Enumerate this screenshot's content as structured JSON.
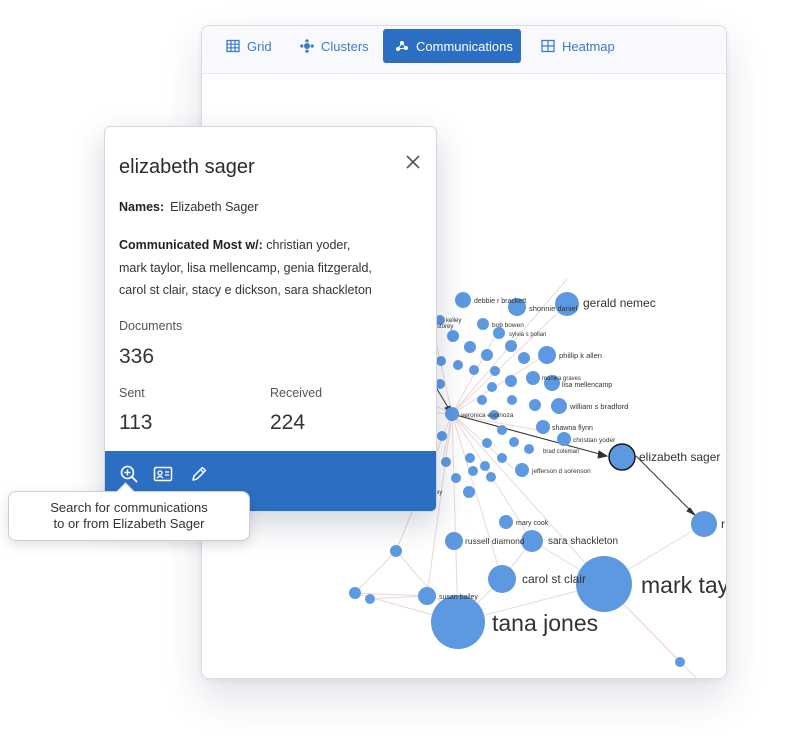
{
  "tabs": [
    {
      "label": "Grid",
      "icon": "grid-icon",
      "active": false
    },
    {
      "label": "Clusters",
      "icon": "clusters-icon",
      "active": false
    },
    {
      "label": "Communications",
      "icon": "communications-icon",
      "active": true
    },
    {
      "label": "Heatmap",
      "icon": "heatmap-icon",
      "active": false
    }
  ],
  "graph": {
    "labels": {
      "debbie": "debbie r brackett",
      "shonnie": "shonnie daniel",
      "gerald": "gerald nemec",
      "kelley": "kelley",
      "story": "l storey",
      "bob": "bob bowen",
      "sylvia": "sylvia s pollan",
      "phillip": "phillip k allen",
      "monika": "monika graves",
      "lisa": "lisa mellencamp",
      "veronica": "veronica espinoza",
      "william": "william s bradford",
      "shawna": "shawna flynn",
      "christian": "christian yoder",
      "brad": "brad coleman",
      "elizabeth": "elizabeth sager",
      "jefferson": "jefferson d sorenson",
      "mary": "mary cook",
      "russell": "russell diamond",
      "sara": "sara shackleton",
      "carol": "carol st clair",
      "mark": "mark taylor",
      "susan": "susan bailey",
      "tana": "tana jones",
      "right_edge": "r",
      "left_edge": "ey"
    }
  },
  "detail": {
    "title": "elizabeth sager",
    "names_label": "Names:",
    "names_value": "Elizabeth Sager",
    "comm_label": "Communicated Most w/:",
    "comm_line1": "christian yoder,",
    "comm_line2": "mark taylor, lisa mellencamp, genia fitzgerald,",
    "comm_line3": "carol st clair, stacy e dickson, sara shackleton",
    "documents_label": "Documents",
    "documents_value": "336",
    "sent_label": "Sent",
    "sent_value": "113",
    "received_label": "Received",
    "received_value": "224",
    "actions": [
      "search-communications-icon",
      "contact-card-icon",
      "edit-pencil-icon"
    ]
  },
  "tooltip": {
    "line1": "Search for communications",
    "line2": "to or from Elizabeth Sager"
  },
  "colors": {
    "accent": "#2c6fc2",
    "node": "#5c99e0",
    "edge": "#e9c7cc",
    "selected_stroke": "#1a1a1a"
  }
}
